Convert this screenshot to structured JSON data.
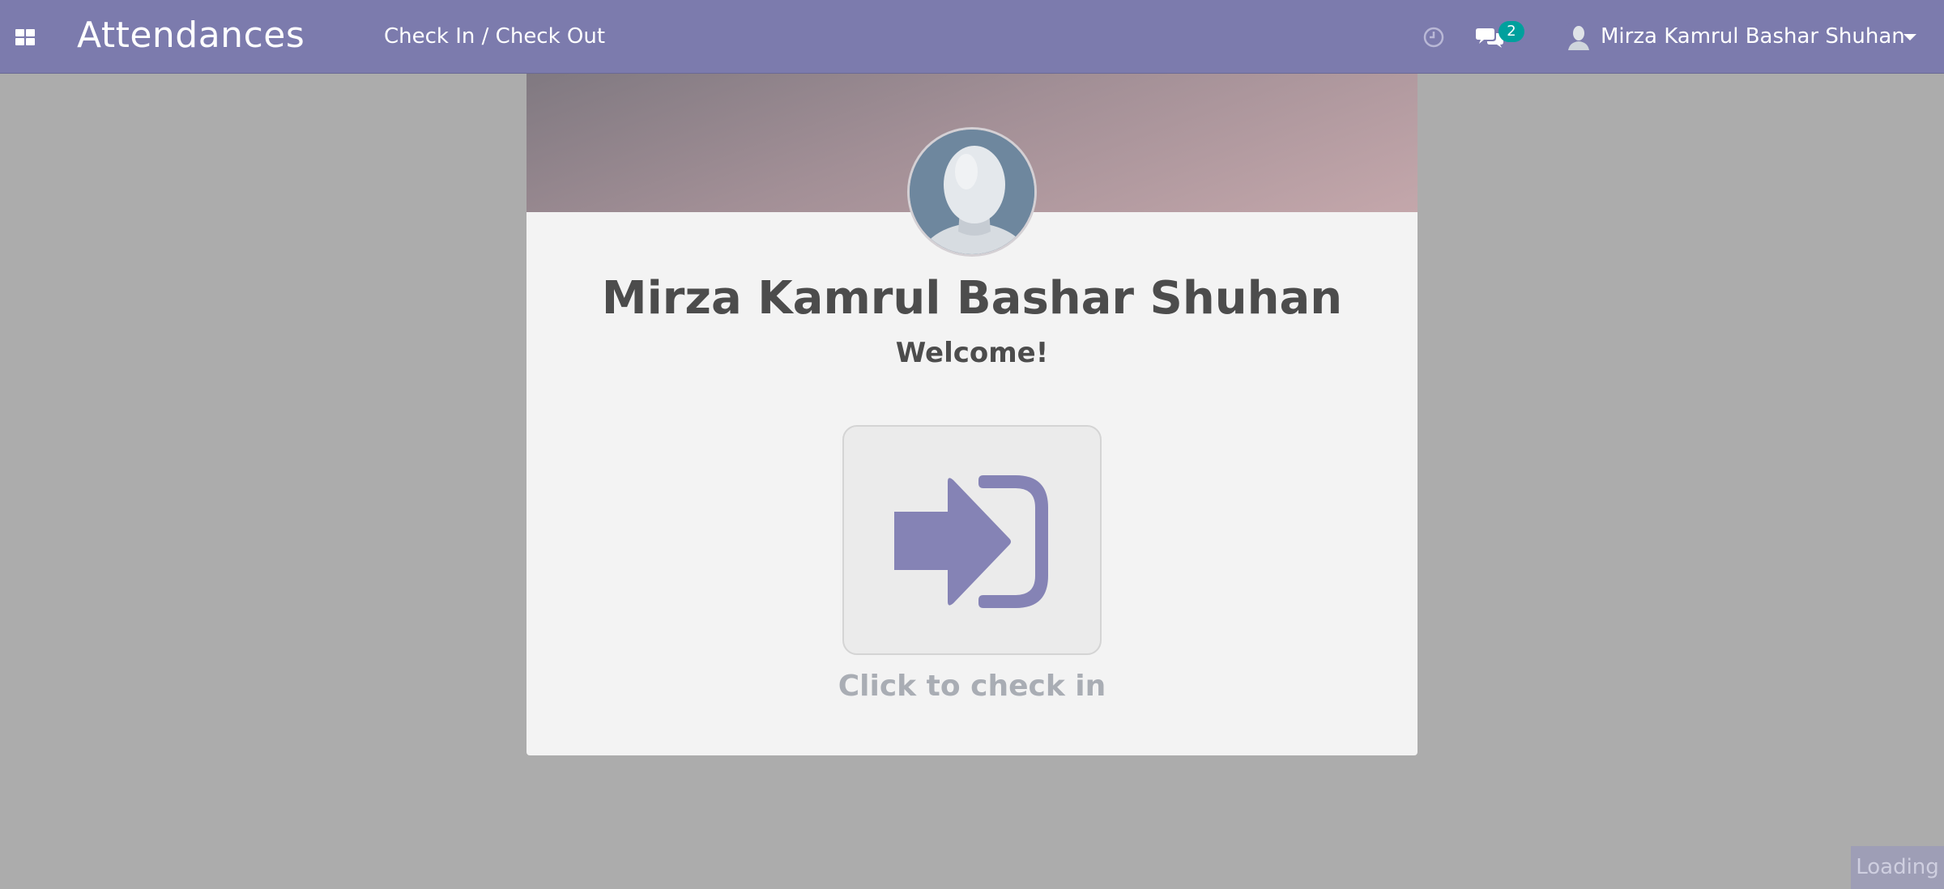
{
  "navbar": {
    "apps_icon": "grid-icon",
    "brand": "Attendances",
    "menu_item": "Check In / Check Out",
    "activity_icon": "clock-icon",
    "messages_icon": "chat-icon",
    "messages_count": "2",
    "user_name": "Mirza Kamrul Bashar Shuhan",
    "colors": {
      "navbar_bg": "#7c7bad",
      "badge_bg": "#00a09d"
    }
  },
  "card": {
    "employee_name": "Mirza Kamrul Bashar Shuhan",
    "welcome": "Welcome!",
    "checkin_icon": "sign-in-icon",
    "checkin_label": "Click to check in",
    "colors": {
      "icon": "#8583b5",
      "label": "#a9adb4"
    }
  },
  "status": {
    "loading": "Loading"
  }
}
